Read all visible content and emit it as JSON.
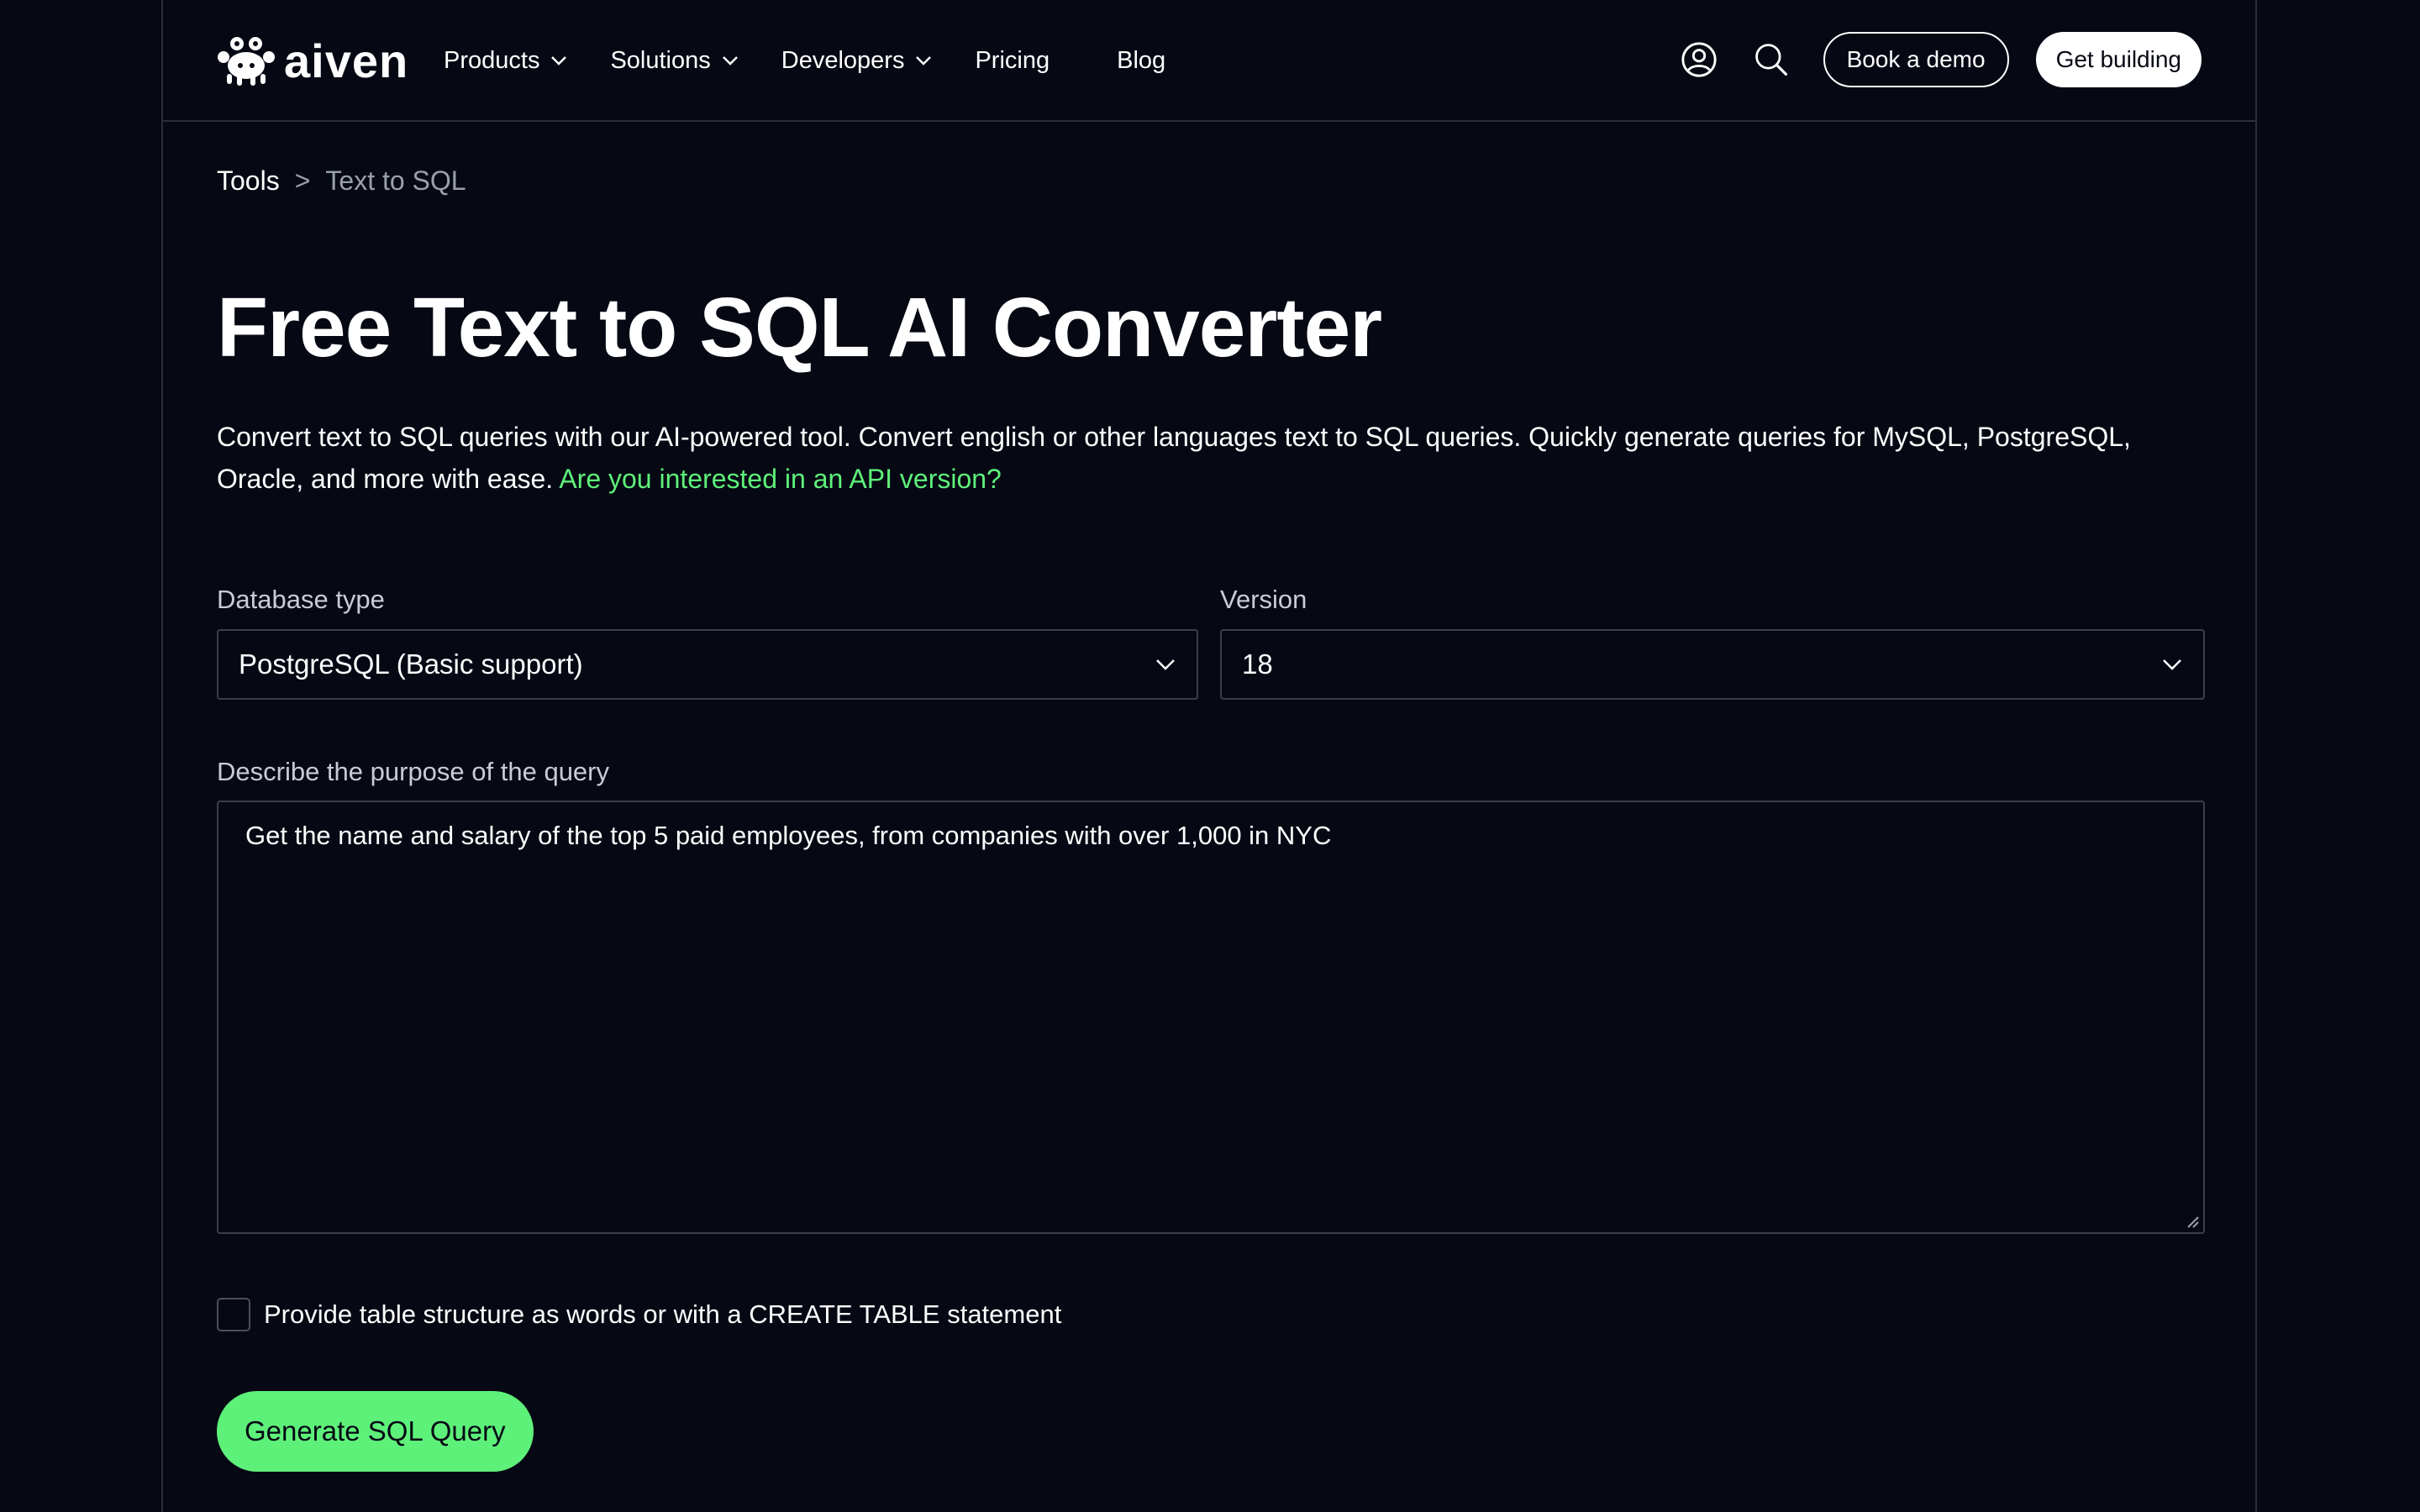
{
  "header": {
    "logo_text": "aiven",
    "nav": [
      {
        "label": "Products",
        "has_dropdown": true
      },
      {
        "label": "Solutions",
        "has_dropdown": true
      },
      {
        "label": "Developers",
        "has_dropdown": true
      },
      {
        "label": "Pricing",
        "has_dropdown": false
      },
      {
        "label": "Blog",
        "has_dropdown": false
      }
    ],
    "account_icon": "user-circle-icon",
    "search_icon": "search-icon",
    "book_demo_label": "Book a demo",
    "get_building_label": "Get building"
  },
  "breadcrumb": {
    "parent": "Tools",
    "separator": ">",
    "current": "Text to SQL"
  },
  "page": {
    "title": "Free Text to SQL AI Converter",
    "description": "Convert text to SQL queries with our AI-powered tool. Convert english or other languages text to SQL queries. Quickly generate queries for MySQL, PostgreSQL, Oracle, and more with ease.",
    "api_link": "Are you interested in an API version?"
  },
  "form": {
    "database_type_label": "Database type",
    "database_type_value": "PostgreSQL (Basic support)",
    "version_label": "Version",
    "version_value": "18",
    "purpose_label": "Describe the purpose of the query",
    "purpose_value": "Get the name and salary of the top 5 paid employees, from companies with over 1,000 in NYC",
    "table_structure_checkbox_label": "Provide table structure as words or with a CREATE TABLE statement",
    "table_structure_checked": false,
    "submit_label": "Generate SQL Query"
  },
  "colors": {
    "background": "#060914",
    "accent_green": "#5ef17a",
    "border": "#3a3f4a",
    "muted_text": "#9aa0ab"
  }
}
